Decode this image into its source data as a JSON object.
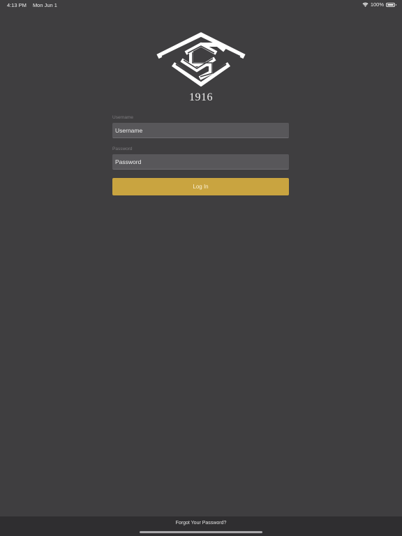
{
  "status_bar": {
    "time": "4:13 PM",
    "date": "Mon Jun 1",
    "battery_percent": "100%",
    "battery_level": 1.0,
    "wifi_icon": "wifi-icon",
    "battery_icon": "battery-icon"
  },
  "branding": {
    "logo_icon": "club-monogram-logo",
    "year": "1916"
  },
  "form": {
    "username_label": "Username",
    "username_placeholder": "Username",
    "username_value": "",
    "password_label": "Password",
    "password_placeholder": "Password",
    "password_value": "",
    "login_label": "Log In"
  },
  "footer": {
    "forgot_password": "Forgot Your Password?"
  },
  "colors": {
    "background": "#3f3e40",
    "field_background": "#58575a",
    "accent": "#c9a440",
    "footer_background": "#2f2e30"
  }
}
